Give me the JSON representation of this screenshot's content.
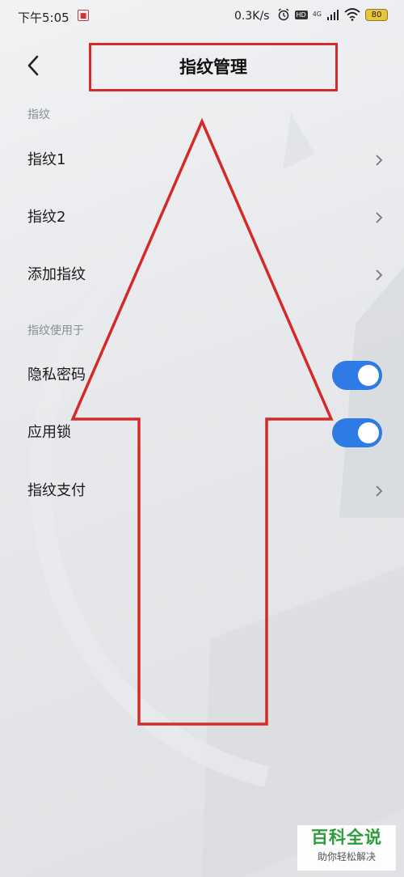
{
  "status_bar": {
    "time": "下午5:05",
    "net_speed": "0.3K/s",
    "hd": "HD",
    "network": "4G",
    "battery": "80"
  },
  "header": {
    "title": "指纹管理"
  },
  "sections": {
    "fingerprint": {
      "label": "指纹",
      "items": [
        "指纹1",
        "指纹2",
        "添加指纹"
      ]
    },
    "usage": {
      "label": "指纹使用于",
      "privacy_password": {
        "label": "隐私密码",
        "enabled": true
      },
      "app_lock": {
        "label": "应用锁",
        "enabled": true
      },
      "fingerprint_pay": {
        "label": "指纹支付"
      }
    }
  },
  "watermark": {
    "title": "百科全说",
    "subtitle": "助你轻松解决"
  },
  "colors": {
    "toggle_on": "#2f7be5",
    "annotation_red": "#d42a2a",
    "watermark_green": "#2c9c3c"
  },
  "icons": {
    "back": "chevron-left-icon",
    "row_nav": "chevron-right-icon",
    "alarm": "alarm-clock-icon",
    "wifi": "wifi-icon",
    "signal": "signal-bars-icon"
  }
}
